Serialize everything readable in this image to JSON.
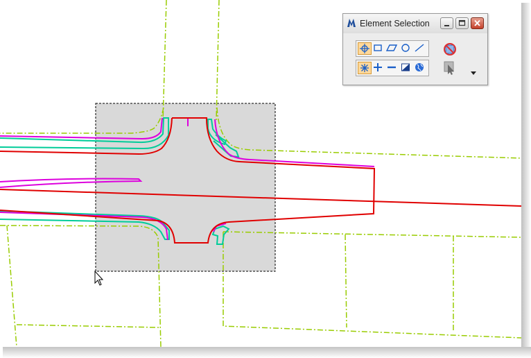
{
  "window": {
    "title": "Element Selection",
    "app_icon": "microstation-icon",
    "controls": [
      "minimize-icon",
      "maximize-icon",
      "close-icon"
    ]
  },
  "tools": {
    "method_row": [
      {
        "name": "individual-select-tool",
        "icon": "crosshair-circle-icon",
        "active": true
      },
      {
        "name": "block-select-tool",
        "icon": "rectangle-icon",
        "active": false
      },
      {
        "name": "shape-select-tool",
        "icon": "parallelogram-icon",
        "active": false
      },
      {
        "name": "circle-select-tool",
        "icon": "circle-icon",
        "active": false
      },
      {
        "name": "line-select-tool",
        "icon": "line-icon",
        "active": false
      }
    ],
    "mode_row": [
      {
        "name": "new-mode-tool",
        "icon": "starburst-icon",
        "active": true
      },
      {
        "name": "add-mode-tool",
        "icon": "plus-icon",
        "active": false
      },
      {
        "name": "subtract-mode-tool",
        "icon": "minus-icon",
        "active": false
      },
      {
        "name": "invert-mode-tool",
        "icon": "invert-icon",
        "active": false
      },
      {
        "name": "select-all-tool",
        "icon": "globe-icon",
        "active": false
      }
    ],
    "side": [
      {
        "name": "clear-selection-tool",
        "icon": "clear-selection-icon"
      },
      {
        "name": "select-tool",
        "icon": "arrow-select-icon"
      }
    ],
    "menu_icon": "dropdown-arrow-icon"
  },
  "colors": {
    "parcel_line": "#99cc00",
    "road_magenta": "#dd00dd",
    "road_teal": "#00cc99",
    "road_red": "#e00000",
    "selection_fill": "#d9d9d9"
  }
}
